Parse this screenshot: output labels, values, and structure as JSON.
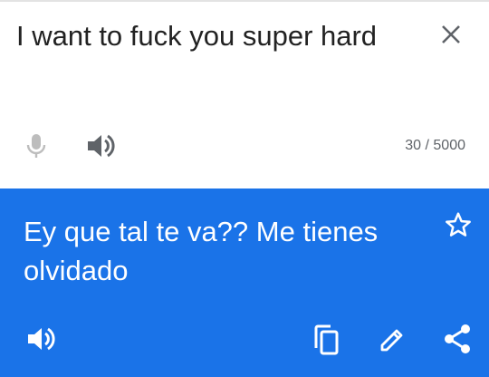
{
  "source": {
    "text": "I want to fuck you super hard",
    "char_count": "30 / 5000"
  },
  "translation": {
    "text": "Ey que tal te va?? Me tienes olvidado"
  },
  "icons": {
    "close": "close-icon",
    "mic": "microphone-icon",
    "speaker": "speaker-icon",
    "star": "star-icon",
    "copy": "copy-icon",
    "edit": "pencil-icon",
    "share": "share-icon"
  },
  "colors": {
    "accent": "#1a73e8",
    "source_text": "#222222",
    "muted": "#5f6368",
    "disabled": "#bdbdbd"
  }
}
